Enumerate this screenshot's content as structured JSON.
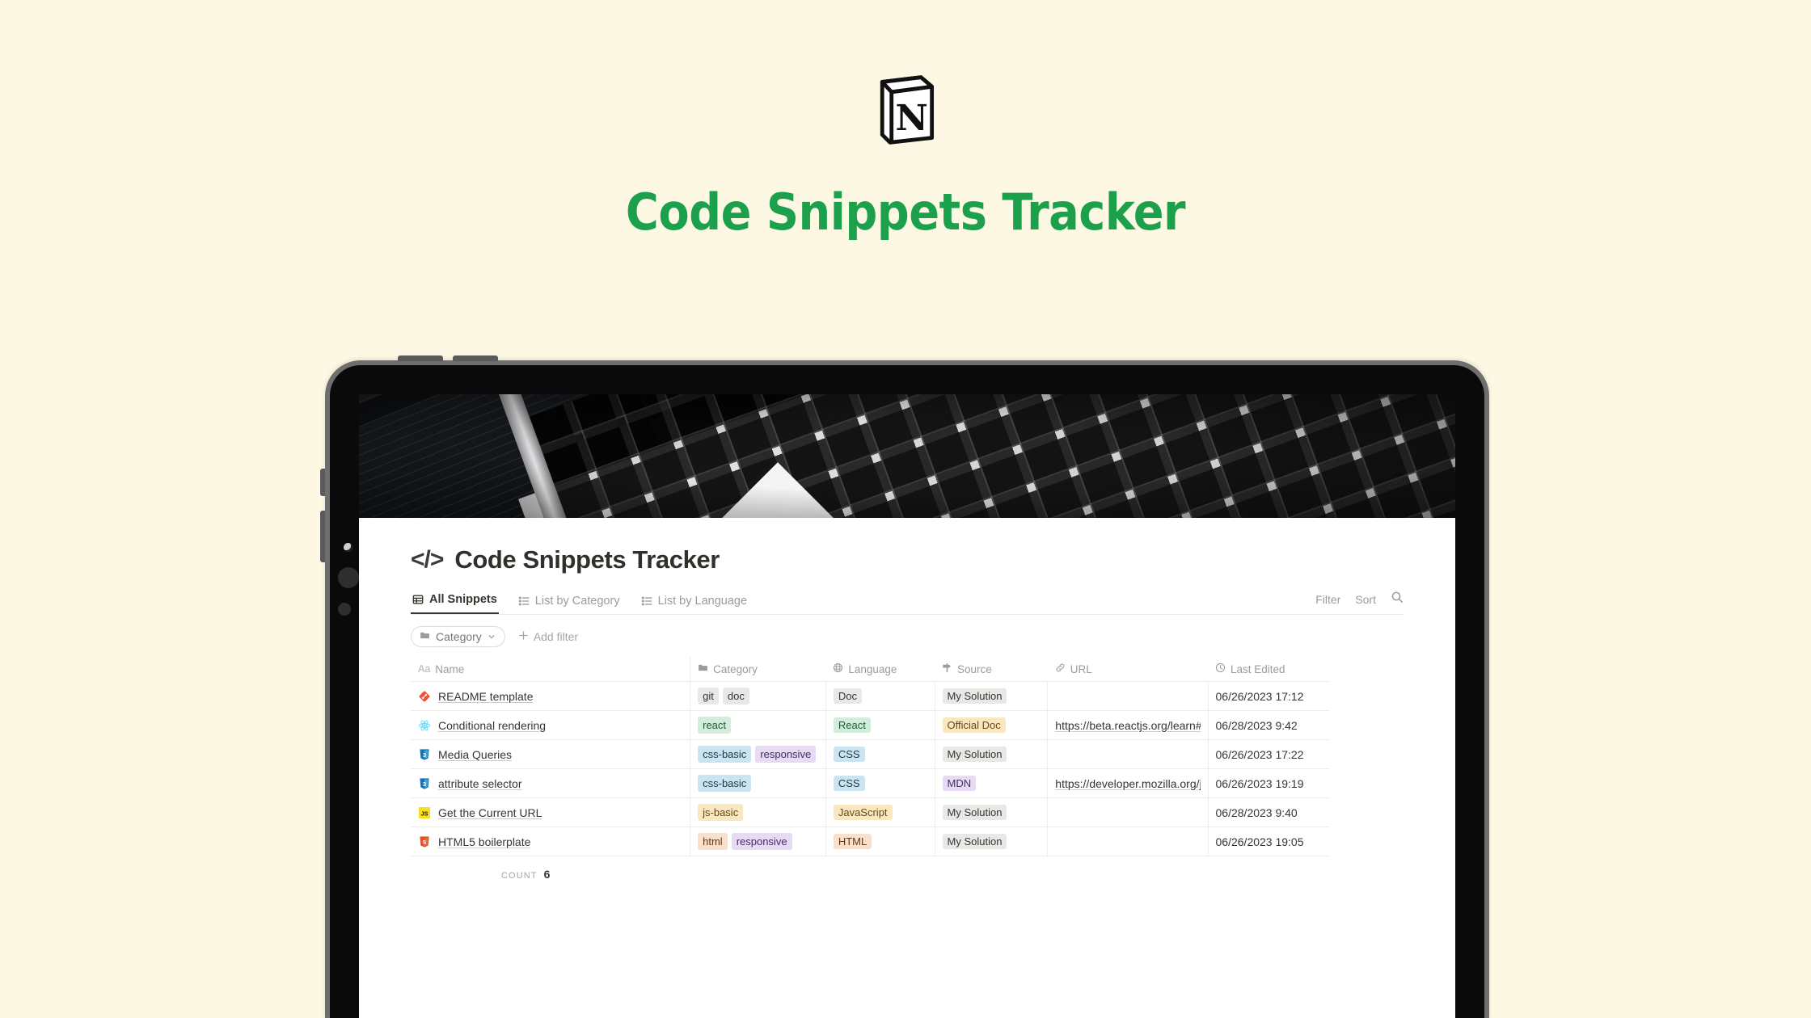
{
  "hero": {
    "logo_icon": "notion-logo-icon",
    "title": "Code Snippets Tracker",
    "title_color": "#1DA04B",
    "background_color": "#FDF8E3"
  },
  "cover": {
    "icon": "cover-photo-laptop-keyboard"
  },
  "page": {
    "icon": "code-brackets-icon",
    "icon_glyph": "</>",
    "title": "Code Snippets Tracker"
  },
  "tabs": [
    {
      "label": "All Snippets",
      "icon": "table-view-icon",
      "active": true
    },
    {
      "label": "List by Category",
      "icon": "list-view-icon",
      "active": false
    },
    {
      "label": "List by Language",
      "icon": "list-view-icon",
      "active": false
    }
  ],
  "tools": {
    "filter_label": "Filter",
    "sort_label": "Sort",
    "search_icon": "search-icon"
  },
  "filter_bar": {
    "pill_label": "Category",
    "pill_icon": "folder-icon",
    "pill_chevron": "chevron-down-icon",
    "add_filter_label": "Add filter",
    "add_filter_icon": "plus-icon"
  },
  "table": {
    "columns": [
      {
        "label": "Name",
        "icon": "text-aa-icon"
      },
      {
        "label": "Category",
        "icon": "folder-icon"
      },
      {
        "label": "Language",
        "icon": "globe-icon"
      },
      {
        "label": "Source",
        "icon": "signpost-icon"
      },
      {
        "label": "URL",
        "icon": "link-icon"
      },
      {
        "label": "Last Edited",
        "icon": "clock-icon"
      }
    ],
    "rows": [
      {
        "icon": "git-icon",
        "name": "README template",
        "category": [
          {
            "text": "git",
            "color": "default"
          },
          {
            "text": "doc",
            "color": "default"
          }
        ],
        "language": {
          "text": "Doc",
          "color": "default"
        },
        "source": {
          "text": "My Solution",
          "color": "default"
        },
        "url": "",
        "last_edited": "06/26/2023 17:12"
      },
      {
        "icon": "react-icon",
        "name": "Conditional rendering",
        "category": [
          {
            "text": "react",
            "color": "green"
          }
        ],
        "language": {
          "text": "React",
          "color": "green"
        },
        "source": {
          "text": "Official Doc",
          "color": "yellow"
        },
        "url": "https://beta.reactjs.org/learn#",
        "last_edited": "06/28/2023 9:42"
      },
      {
        "icon": "css3-icon",
        "name": "Media Queries",
        "category": [
          {
            "text": "css-basic",
            "color": "blue"
          },
          {
            "text": "responsive",
            "color": "purple"
          }
        ],
        "language": {
          "text": "CSS",
          "color": "blue"
        },
        "source": {
          "text": "My Solution",
          "color": "default"
        },
        "url": "",
        "last_edited": "06/26/2023 17:22"
      },
      {
        "icon": "css3-icon",
        "name": "attribute selector",
        "category": [
          {
            "text": "css-basic",
            "color": "blue"
          }
        ],
        "language": {
          "text": "CSS",
          "color": "blue"
        },
        "source": {
          "text": "MDN",
          "color": "purple"
        },
        "url": "https://developer.mozilla.org/j",
        "last_edited": "06/26/2023 19:19"
      },
      {
        "icon": "javascript-icon",
        "name": "Get the Current URL",
        "category": [
          {
            "text": "js-basic",
            "color": "yellow"
          }
        ],
        "language": {
          "text": "JavaScript",
          "color": "yellow"
        },
        "source": {
          "text": "My Solution",
          "color": "default"
        },
        "url": "",
        "last_edited": "06/28/2023 9:40"
      },
      {
        "icon": "html5-icon",
        "name": "HTML5 boilerplate",
        "category": [
          {
            "text": "html",
            "color": "orange"
          },
          {
            "text": "responsive",
            "color": "purple"
          }
        ],
        "language": {
          "text": "HTML",
          "color": "orange"
        },
        "source": {
          "text": "My Solution",
          "color": "default"
        },
        "url": "",
        "last_edited": "06/26/2023 19:05"
      }
    ],
    "count_label": "COUNT",
    "count_value": "6"
  }
}
